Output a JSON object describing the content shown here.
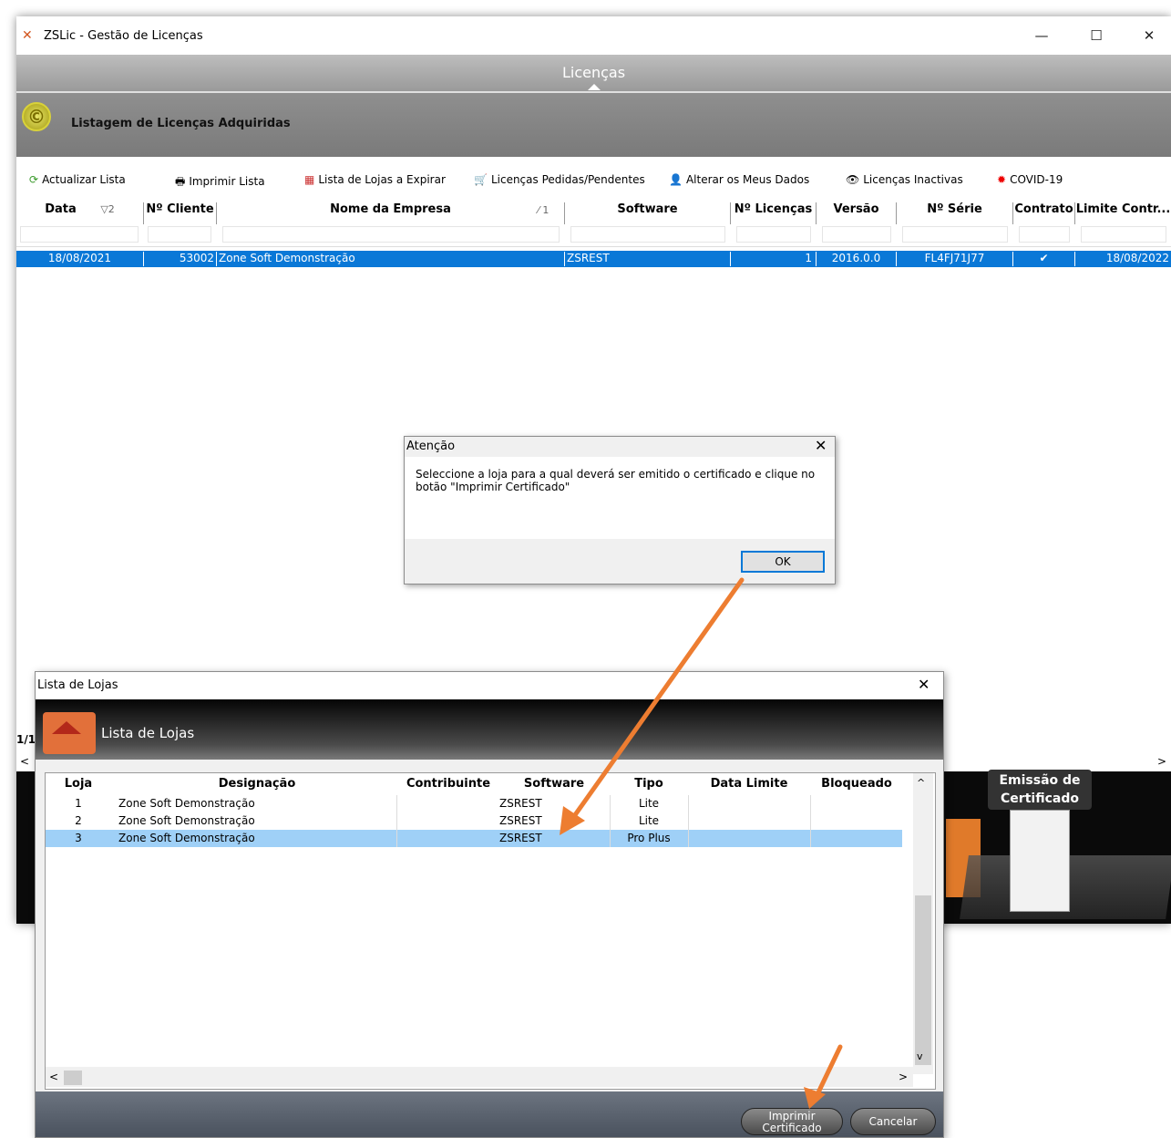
{
  "app": {
    "title": "ZSLic - Gestão de Licenças",
    "minimize": "—",
    "maximize": "☐",
    "close": "✕",
    "nav_title": "Licenças",
    "header_title": "Listagem de Licenças Adquiridas"
  },
  "toolbar": {
    "refresh": "Actualizar Lista",
    "print": "Imprimir Lista",
    "expiring": "Lista de Lojas a Expirar",
    "requested": "Licenças Pedidas/Pendentes",
    "change_data": "Alterar os Meus Dados",
    "inactive": "Licenças Inactivas",
    "covid": "COVID-19"
  },
  "grid": {
    "columns": [
      "Data",
      "Nº Cliente",
      "Nome da Empresa",
      "Software",
      "Nº Licenças",
      "Versão",
      "Nº Série",
      "Contrato",
      "Limite Contr..."
    ],
    "sort_data": "▽2",
    "sort_nome": "⁄ 1",
    "row": {
      "data": "18/08/2021",
      "cliente": "53002",
      "empresa": "Zone Soft Demonstração",
      "software": "ZSREST",
      "licencas": "1",
      "versao": "2016.0.0",
      "serie": "FL4FJ71J77",
      "contrato": "✔",
      "limite": "18/08/2022"
    },
    "status_count": "1/1"
  },
  "attention": {
    "title": "Atenção",
    "close": "✕",
    "message": "Seleccione a loja para a qual deverá ser emitido o certificado e clique no botão \"Imprimir Certificado\"",
    "ok": "OK"
  },
  "emissao": {
    "label": "Emissão de Certificado"
  },
  "lojas": {
    "window_title": "Lista de Lojas",
    "close": "✕",
    "banner_title": "Lista de Lojas",
    "columns": [
      "Loja",
      "Designação",
      "Contribuinte",
      "Software",
      "Tipo",
      "Data Limite",
      "Bloqueado"
    ],
    "rows": [
      {
        "loja": "1",
        "designacao": "Zone Soft Demonstração",
        "contribuinte": "",
        "software": "ZSREST",
        "tipo": "Lite",
        "data_limite": "",
        "bloqueado": ""
      },
      {
        "loja": "2",
        "designacao": "Zone Soft Demonstração",
        "contribuinte": "",
        "software": "ZSREST",
        "tipo": "Lite",
        "data_limite": "",
        "bloqueado": ""
      },
      {
        "loja": "3",
        "designacao": "Zone Soft Demonstração",
        "contribuinte": "",
        "software": "ZSREST",
        "tipo": "Pro Plus",
        "data_limite": "",
        "bloqueado": ""
      }
    ],
    "print_button_line1": "Imprimir",
    "print_button_line2": "Certificado",
    "cancel_button": "Cancelar"
  },
  "colors": {
    "selection": "#0a78d7",
    "lojas_selection": "#9fd0f7",
    "arrow": "#ed7d31"
  }
}
